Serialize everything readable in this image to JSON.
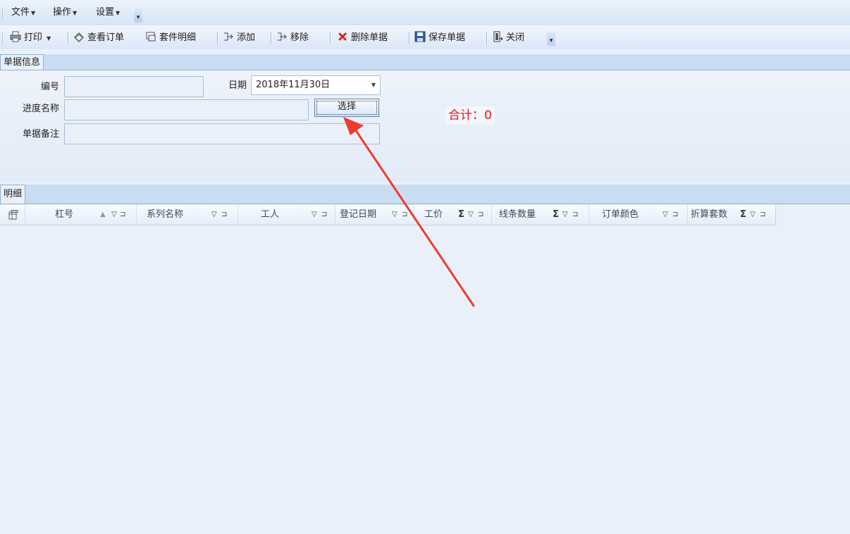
{
  "menu": {
    "items": [
      {
        "label": "文件"
      },
      {
        "label": "操作"
      },
      {
        "label": "设置"
      }
    ]
  },
  "toolbar": {
    "print": "打印",
    "view_order": "查看订单",
    "kit_detail": "套件明细",
    "add": "添加",
    "remove": "移除",
    "delete_doc": "删除单据",
    "save_doc": "保存单据",
    "close": "关闭"
  },
  "doc_info": {
    "tab_label": "单据信息",
    "number_label": "编号",
    "number_value": "",
    "date_label": "日期",
    "date_value": "2018年11月30日",
    "progress_label": "进度名称",
    "progress_value": "",
    "select_button": "选择",
    "remark_label": "单据备注",
    "remark_value": "",
    "total": "合计：0"
  },
  "detail": {
    "tab_label": "明细",
    "columns": [
      {
        "label": "杠号",
        "sigma": false,
        "sort": true
      },
      {
        "label": "系列名称",
        "sigma": false,
        "sort": false
      },
      {
        "label": "工人",
        "sigma": false,
        "sort": false
      },
      {
        "label": "登记日期",
        "sigma": false,
        "sort": false
      },
      {
        "label": "工价",
        "sigma": true,
        "sort": false
      },
      {
        "label": "线条数量",
        "sigma": true,
        "sort": false
      },
      {
        "label": "订单颜色",
        "sigma": false,
        "sort": false
      },
      {
        "label": "折算套数",
        "sigma": true,
        "sort": false
      }
    ]
  },
  "colors": {
    "accent_red": "#e8101b",
    "tab_strip": "#c9dcf3",
    "background": "#e9f0f9"
  }
}
